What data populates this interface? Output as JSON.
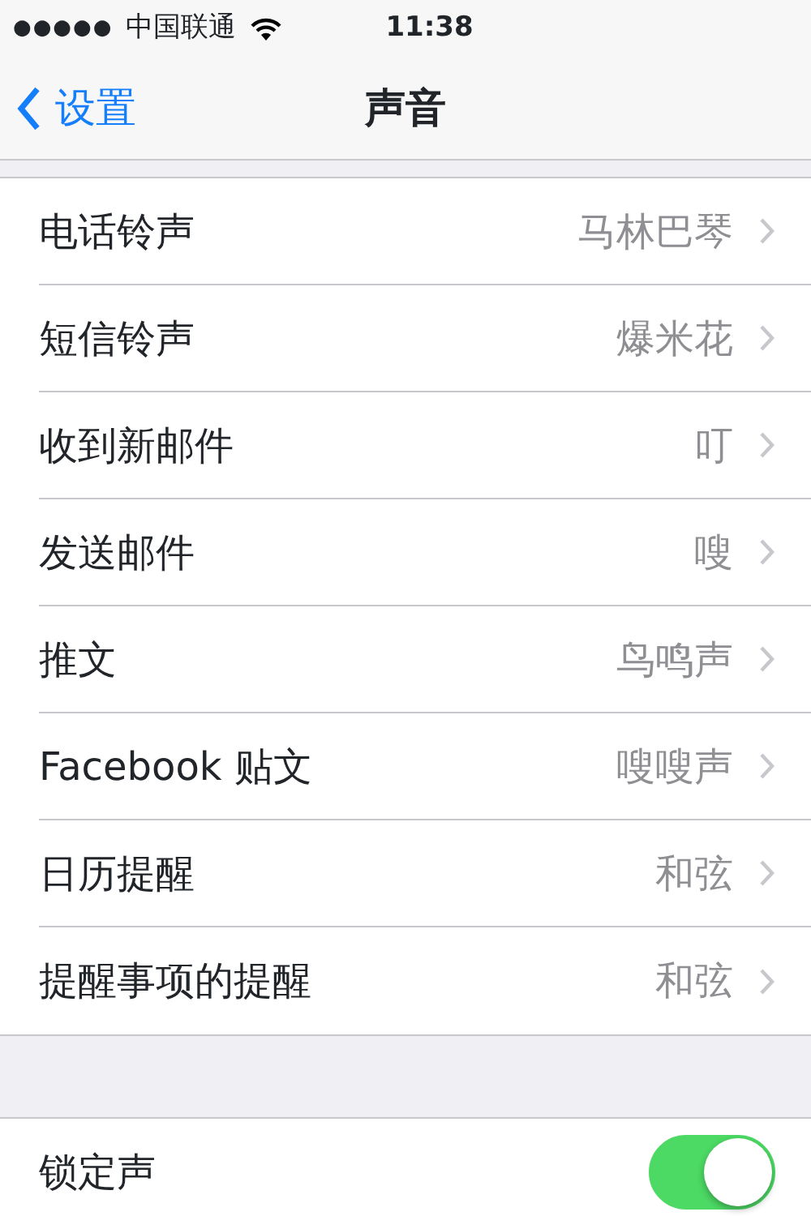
{
  "status_bar": {
    "signal": "●●●●●",
    "carrier": "中国联通",
    "time": "11:38"
  },
  "nav": {
    "back": "设置",
    "title": "声音"
  },
  "sounds": [
    {
      "label": "电话铃声",
      "value": "马林巴琴"
    },
    {
      "label": "短信铃声",
      "value": "爆米花"
    },
    {
      "label": "收到新邮件",
      "value": "叮"
    },
    {
      "label": "发送邮件",
      "value": "嗖"
    },
    {
      "label": "推文",
      "value": "鸟鸣声"
    },
    {
      "label": "Facebook 贴文",
      "value": "嗖嗖声"
    },
    {
      "label": "日历提醒",
      "value": "和弦"
    },
    {
      "label": "提醒事项的提醒",
      "value": "和弦"
    }
  ],
  "toggles": [
    {
      "label": "锁定声",
      "on": true
    }
  ]
}
